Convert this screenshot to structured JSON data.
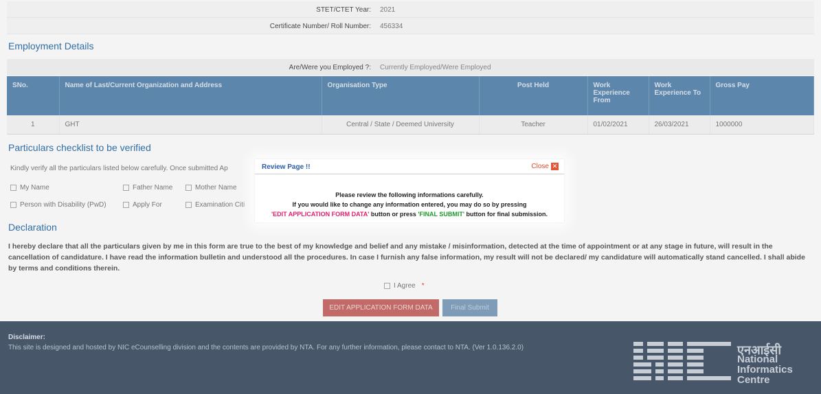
{
  "top_rows": [
    {
      "label": "STET/CTET Year:",
      "value": "2021"
    },
    {
      "label": "Certificate Number/ Roll Number:",
      "value": "456334"
    }
  ],
  "employment": {
    "title": "Employment Details",
    "question_label": "Are/Were you Employed ?:",
    "question_value": "Currently Employed/Were Employed",
    "headers": [
      "SNo.",
      "Name of Last/Current Organization and Address",
      "Organisation Type",
      "Post Held",
      "Work Experience From",
      "Work Experience To",
      "Gross Pay"
    ],
    "rows": [
      [
        "1",
        "GHT",
        "Central / State / Deemed University",
        "Teacher",
        "01/02/2021",
        "26/03/2021",
        "1000000"
      ]
    ]
  },
  "checklist": {
    "title": "Particulars checklist to be verified",
    "instruction": "Kindly verify all the particulars listed below carefully. Once submitted Ap",
    "items": [
      "My Name",
      "Father Name",
      "Mother Name",
      "Person with Disability (PwD)",
      "Apply For",
      "Examination Citi"
    ]
  },
  "declaration": {
    "title": "Declaration",
    "text": "I hereby declare that all the particulars given by me in this form are true to the best of my knowledge and belief and any mistake / misinformation, detected at the time of appointment or at any stage in future, will result in the cancellation of candidature. I have read the information bulletin and understood all the procedures. In case I furnish any false information, my result will not be declared/ my candidature will automatically stand cancelled. I shall abide by terms and conditions therein.",
    "agree_label": "I Agree",
    "required_mark": "*"
  },
  "buttons": {
    "edit": "EDIT APPLICATION FORM DATA",
    "final": "Final Submit"
  },
  "footer": {
    "disclaimer_title": "Disclaimer:",
    "disclaimer_text": "This site is designed and hosted by NIC eCounselling division and the contents are provided by NTA. For any further information, please contact to NTA. (Ver 1.0.136.2.0)",
    "logo_hindi": "एनआईसी",
    "logo_line1": "National",
    "logo_line2": "Informatics",
    "logo_line3": "Centre"
  },
  "modal": {
    "title": "Review Page !!",
    "close_label": "Close",
    "line1": "Please review the following informations carefully.",
    "line2": "If you would like to change any information entered, you may do so by pressing",
    "edit_ref": "'EDIT APPLICATION FORM DATA'",
    "mid": " button or press ",
    "final_ref": "'FINAL SUBMIT'",
    "end": " button for final submission."
  },
  "colors": {
    "header_blue": "#5b88b0",
    "footer_bg": "#48566a",
    "section_title": "#2b6ea8",
    "edit_button": "#c96a66",
    "final_button": "#7f9fbd"
  }
}
